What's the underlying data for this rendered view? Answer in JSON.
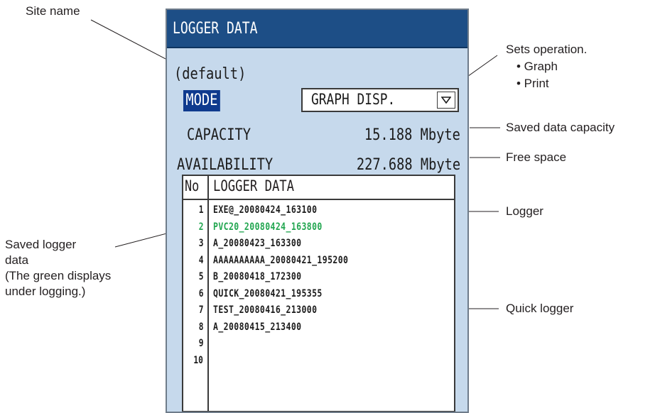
{
  "colors": {
    "title_bar": "#1d4e86",
    "panel_bg": "#c6d9ec",
    "active_row": "#22a650",
    "mode_highlight": "#0f3a8e"
  },
  "callouts": {
    "site_name": "Site name",
    "sets_operation": "Sets operation.",
    "graph": "• Graph",
    "print": "• Print",
    "saved_capacity": "Saved data capacity",
    "free_space": "Free space",
    "logger": "Logger",
    "saved_logger_1": "Saved logger",
    "saved_logger_2": "data",
    "saved_logger_3": "(The green displays",
    "saved_logger_4": "under logging.)",
    "quick_logger": "Quick logger"
  },
  "panel": {
    "title": "LOGGER DATA",
    "site": "(default)",
    "mode_label": "MODE",
    "mode_value": "GRAPH DISP.",
    "dropdown_icon": "chevron-down-icon",
    "capacity_label": "CAPACITY",
    "capacity_value": "15.188 Mbyte",
    "availability_label": "AVAILABILITY",
    "availability_value": "227.688 Mbyte"
  },
  "list": {
    "col_no": "No",
    "col_name": "LOGGER DATA",
    "rows": [
      {
        "no": "1",
        "name": "EXE@_20080424_163100"
      },
      {
        "no": "2",
        "name": "PVC20_20080424_163800"
      },
      {
        "no": "3",
        "name": "A_20080423_163300"
      },
      {
        "no": "4",
        "name": "AAAAAAAAAA_20080421_195200"
      },
      {
        "no": "5",
        "name": "B_20080418_172300"
      },
      {
        "no": "6",
        "name": "QUICK_20080421_195355"
      },
      {
        "no": "7",
        "name": "TEST_20080416_213000"
      },
      {
        "no": "8",
        "name": "A_20080415_213400"
      },
      {
        "no": "9",
        "name": ""
      },
      {
        "no": "10",
        "name": ""
      }
    ]
  }
}
